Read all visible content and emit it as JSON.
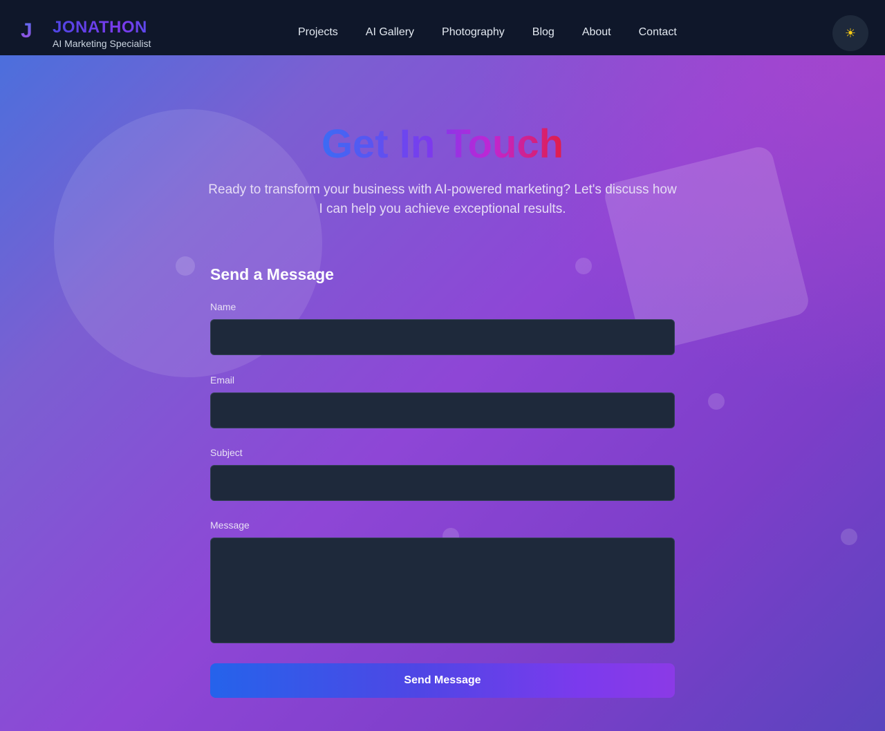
{
  "nav": {
    "brand_mark": "J",
    "brand_name": "JONATHON",
    "brand_tagline": "AI Marketing Specialist",
    "links": [
      "Projects",
      "AI Gallery",
      "Photography",
      "Blog",
      "About",
      "Contact"
    ],
    "theme_toggle_icon": "sun-icon",
    "theme_toggle_glyph": "☀"
  },
  "hero": {
    "title": "Get In Touch",
    "subtitle": "Ready to transform your business with AI-powered marketing? Let's discuss how I can help you achieve exceptional results."
  },
  "form": {
    "heading": "Send a Message",
    "name_label": "Name",
    "name_value": "",
    "email_label": "Email",
    "email_value": "",
    "subject_label": "Subject",
    "subject_value": "",
    "message_label": "Message",
    "message_value": "",
    "submit_label": "Send Message"
  },
  "colors": {
    "nav_bg": "#0f172a",
    "field_bg": "#1e293b",
    "accent_blue": "#2563eb",
    "accent_purple": "#7c3aed",
    "toggle_icon": "#facc15"
  }
}
